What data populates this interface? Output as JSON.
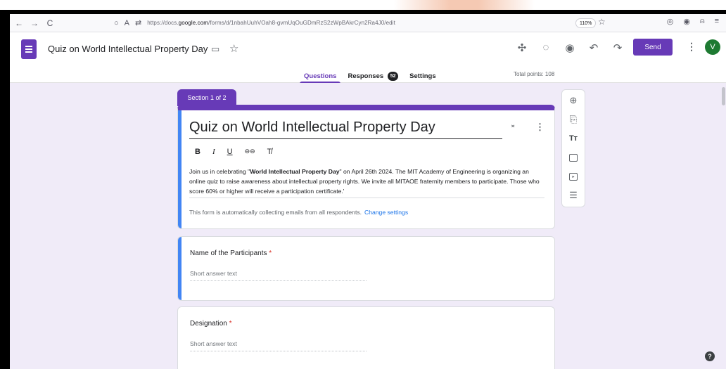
{
  "browser": {
    "url_prefix": "https://docs.",
    "url_domain": "google.com",
    "url_rest": "/forms/d/1nbahUuhVOah8-gvmUqOuGDmRzS2zWpBAkrCyn2Ra4J0/edit",
    "zoom": "110%"
  },
  "header": {
    "doc_title": "Quiz on World Intellectual Property Day",
    "send_label": "Send",
    "avatar_letter": "V"
  },
  "tabs": {
    "questions": "Questions",
    "responses": "Responses",
    "responses_count": "52",
    "settings": "Settings",
    "total_points": "Total points: 108"
  },
  "section": {
    "label": "Section 1 of 2"
  },
  "form": {
    "title": "Quiz on World Intellectual Property Day",
    "format_bold": "B",
    "format_italic": "I",
    "format_underline": "U",
    "format_link": "⊖⊖",
    "format_clear": "T̸",
    "desc_part1": "Join us in celebrating \"",
    "desc_bold": "World Intellectual Property Day",
    "desc_part2": "\" on April 26th 2024.  The MIT Academy of Engineering is organizing an online quiz to raise awareness about intellectual property rights. We invite all MITAOE fraternity members to participate. Those who score 60% or higher will receive a participation certificate.'",
    "email_note": "This form is automatically collecting emails from all respondents.",
    "change_settings": "Change settings"
  },
  "questions": [
    {
      "title": "Name of the Participants",
      "required": "*",
      "placeholder": "Short answer text"
    },
    {
      "title": "Designation",
      "required": "*",
      "placeholder": "Short answer text"
    }
  ],
  "icons": {
    "back": "←",
    "forward": "→",
    "reload": "C",
    "shield": "○",
    "lock": "A",
    "permissions": "⇄",
    "bookmark_star": "☆",
    "pocket": "◎",
    "account": "◉",
    "extensions": "⍝",
    "menu": "≡",
    "addon": "✣",
    "palette": "◌",
    "preview": "◉",
    "undo": "↶",
    "redo": "↷",
    "more": "⋮",
    "folder": "▭",
    "star": "☆",
    "collapse": "⌄⌃",
    "add_question": "⊕",
    "import_questions": "⎘",
    "title_text": "Tт",
    "image": "▣",
    "video": "▶",
    "section": "☰",
    "help": "?"
  }
}
